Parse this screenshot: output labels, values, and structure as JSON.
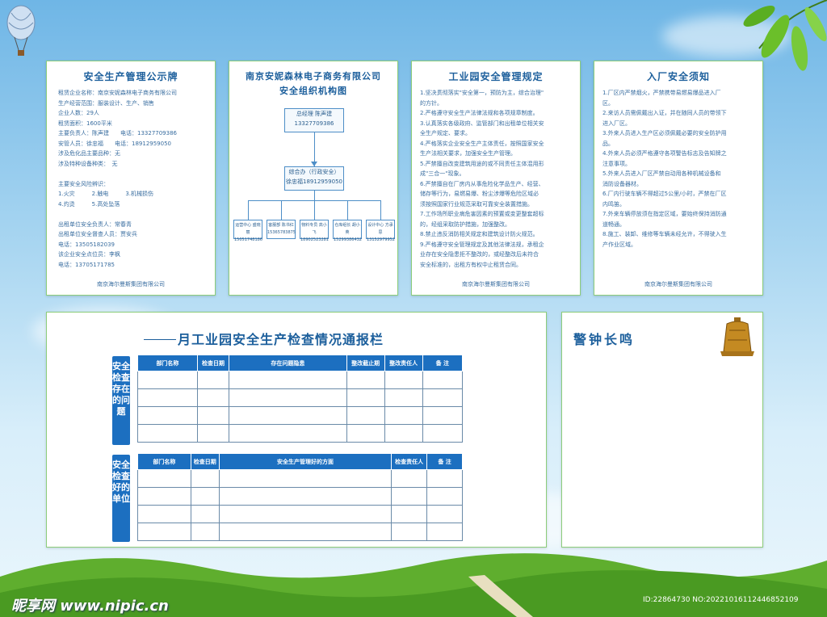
{
  "panel1": {
    "title": "安全生产管理公示牌",
    "lines": [
      "租赁企业名称：南京安妮森林电子商务有限公司",
      "生产经营范围：服装设计、生产、销售",
      "企业人数：29人",
      "租赁面积：1600平米",
      "主要负责人：陈声建　　电话：13327709386",
      "安管人员：徐忠福　　电话：18912959050",
      "涉及危化品主要品种：无",
      "涉及特种设备种类：　无",
      "",
      "主要安全风险辨识：",
      "1.火灾　　　2.触电　　　3.机械损伤",
      "4.灼烫　　　5.高处坠落",
      "",
      "出租单位安全负责人：常春青",
      "出租单位安全督查人员：贾安兵",
      "电话：13505182039",
      "该企业安全点位员：李枫",
      "电话：13705171785"
    ],
    "footer": "南京海尔曼斯集团有限公司"
  },
  "panel2": {
    "title_line1": "南京安妮森林电子商务有限公司",
    "title_line2": "安全组织机构图",
    "top_box_line1": "总经理  陈声建",
    "top_box_line2": "13327709386",
    "mid_box_line1": "综合办（行政安全）",
    "mid_box_line2": "徐忠福18912959050",
    "leaves": [
      {
        "line1": "运营中心 盛晓丽",
        "line2": "15051748186"
      },
      {
        "line1": "客服部 陈书红",
        "line2": "15365783875"
      },
      {
        "line1": "物料专员 高小飞",
        "line2": "18902523281"
      },
      {
        "line1": "仓库组长 胡小英",
        "line2": "15299386432"
      },
      {
        "line1": "设计中心 方承思",
        "line2": "13152979952"
      }
    ]
  },
  "panel3": {
    "title": "工业园安全管理规定",
    "lines": [
      "1.坚决贯彻落实\"安全第一，预防为主，综合治理\"",
      "的方针。",
      "2.严格遵守安全生产法律法规和各项规章制度。",
      "3.认真落实各级政府、监管部门和出租单位相关安",
      "全生产规定、要求。",
      "4.严格落实企业安全生产主体责任，按照国家安全",
      "生产法相关要求，加强安全生产管理。",
      "5.严禁擅自改变建筑用途的或不同责任主体混用形",
      "成\"三合一\"现象。",
      "6.严禁擅自在厂房内从事危险化学品生产、经营、",
      "储存等行为，易燃易爆、粉尘涉爆等危险区域必",
      "须按照国家行业规范采取可靠安全装置措施。",
      "7.工作场所职业病危害因素的预置或变更整套超标",
      "的，经组采取防护措施，加强整改。",
      "8.禁止违反消防相关规定和建筑设计防火规范。",
      "9.严格遵守安全管理规定及其他法律法规，承租企",
      "业存在安全隐患拒不整改的，或经整改后未符合",
      "安全标准的，出租方有权中止租赁合同。"
    ],
    "footer": "南京海尔曼斯集团有限公司"
  },
  "panel4": {
    "title": "入厂安全须知",
    "lines": [
      "1.厂区内严禁烟火，严禁携带易燃易爆品进入厂",
      "区。",
      "2.来访人员需佩戴出入证，并在随同人员的带领下",
      "进入厂区。",
      "3.外来人员进入生产区必须佩戴必要的安全防护用",
      "品。",
      "4.外来人员必须严格遵守各项警告标志及告知牌之",
      "注意事项。",
      "5.外来人员进入厂区严禁自动用各种机械设备和",
      "消防设备器材。",
      "6.厂内行驶车辆不得超过5公里/小时，严禁在厂区",
      "内鸣笛。",
      "7.外来车辆停放须在指定区域，要始终保持消防通",
      "道畅通。",
      "8.施工、装卸、维修等车辆未经允许，不得驶入生",
      "产作业区域。"
    ],
    "footer": "南京海尔曼斯集团有限公司"
  },
  "report": {
    "title": "月工业园安全生产检查情况通报栏",
    "label_problems": "安全检查存在的问题",
    "label_good": "安全检查好的单位",
    "table1_headers": [
      "部门名称",
      "检查日期",
      "存在问题隐患",
      "整改截止期",
      "整改责任人",
      "备 注"
    ],
    "table2_headers": [
      "部门名称",
      "检查日期",
      "安全生产管理好的方面",
      "检查责任人",
      "备 注"
    ]
  },
  "alarm": {
    "title": "警钟长鸣"
  },
  "watermark": {
    "logo": "昵享网 www.nipic.cn",
    "id": "ID:22864730 NO:20221016112446852109"
  }
}
